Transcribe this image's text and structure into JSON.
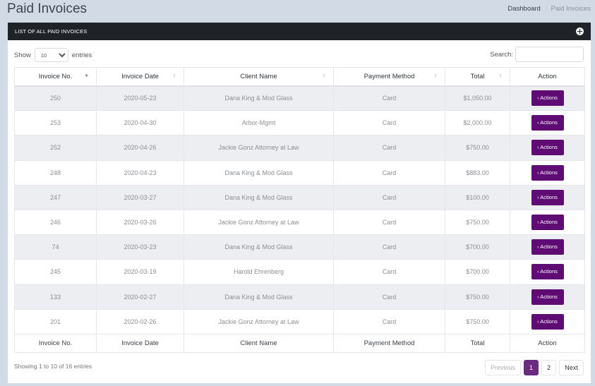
{
  "header": {
    "title": "Paid Invoices",
    "breadcrumb": [
      {
        "label": "Dashboard"
      },
      {
        "label": "Paid Invoices"
      }
    ],
    "breadcrumb_separator": "/"
  },
  "card": {
    "title": "LIST OF ALL PAID INVOICES",
    "header_icon": "globe-icon"
  },
  "length": {
    "prefix": "Show",
    "selected": "10",
    "suffix": "entries"
  },
  "search": {
    "label": "Search:",
    "value": ""
  },
  "table": {
    "columns": [
      "Invoice No.",
      "Invoice Date",
      "Client Name",
      "Payment Method",
      "Total",
      "Action"
    ],
    "sorted_column": "Invoice No.",
    "sort_direction": "desc",
    "action_label": "‹ Actions",
    "rows": [
      {
        "invoice_no": "250",
        "date": "2020-05-23",
        "client": "Dana King & Mod Glass",
        "method": "Card",
        "total": "$1,050.00"
      },
      {
        "invoice_no": "253",
        "date": "2020-04-30",
        "client": "Arbor-Mgmt",
        "method": "Card",
        "total": "$2,000.00"
      },
      {
        "invoice_no": "252",
        "date": "2020-04-26",
        "client": "Jackie Gonz Attorney at Law",
        "method": "Card",
        "total": "$750.00"
      },
      {
        "invoice_no": "248",
        "date": "2020-04-23",
        "client": "Dana King & Mod Glass",
        "method": "Card",
        "total": "$883.00"
      },
      {
        "invoice_no": "247",
        "date": "2020-03-27",
        "client": "Dana King & Mod Glass",
        "method": "Card",
        "total": "$100.00"
      },
      {
        "invoice_no": "246",
        "date": "2020-03-26",
        "client": "Jackie Gonz Attorney at Law",
        "method": "Card",
        "total": "$750.00"
      },
      {
        "invoice_no": "74",
        "date": "2020-03-23",
        "client": "Dana King & Mod Glass",
        "method": "Card",
        "total": "$700.00"
      },
      {
        "invoice_no": "245",
        "date": "2020-03-19",
        "client": "Harold Ehrenberg",
        "method": "Card",
        "total": "$700.00"
      },
      {
        "invoice_no": "133",
        "date": "2020-02-27",
        "client": "Dana King & Mod Glass",
        "method": "Card",
        "total": "$750.00"
      },
      {
        "invoice_no": "201",
        "date": "2020-02-26",
        "client": "Jackie Gonz Attorney at Law",
        "method": "Card",
        "total": "$750.00"
      }
    ]
  },
  "footer": {
    "info": "Showing 1 to 10 of 16 entries",
    "pagination": {
      "previous": "Previous",
      "pages": [
        "1",
        "2"
      ],
      "current": "1",
      "next": "Next"
    }
  },
  "colors": {
    "accent": "#5e0b73",
    "pagination_active": "#6b2b7f",
    "card_header_bg": "#1f2226",
    "page_bg": "#d2dbe5"
  }
}
